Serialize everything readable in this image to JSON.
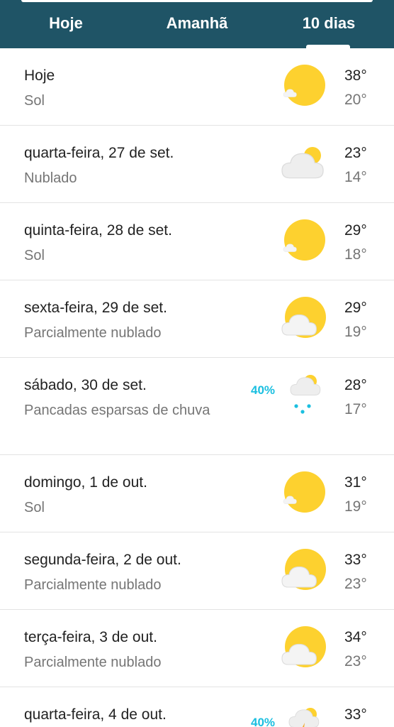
{
  "tabs": [
    {
      "label": "Hoje"
    },
    {
      "label": "Amanhã"
    },
    {
      "label": "10 dias"
    }
  ],
  "selected_tab": "10 dias",
  "colors": {
    "header": "#1f5466",
    "sun": "#fdd12f",
    "cloud": "#eeeeee",
    "rain": "#1bbfe0",
    "primary_text": "#222222",
    "secondary_text": "#757575"
  },
  "days": [
    {
      "date": "Hoje",
      "condition": "Sol",
      "high": "38°",
      "low": "20°",
      "icon": "sun-icon",
      "precip": ""
    },
    {
      "date": "quarta-feira, 27 de set.",
      "condition": "Nublado",
      "high": "23°",
      "low": "14°",
      "icon": "cloudy-icon",
      "precip": ""
    },
    {
      "date": "quinta-feira, 28 de set.",
      "condition": "Sol",
      "high": "29°",
      "low": "18°",
      "icon": "sun-icon",
      "precip": ""
    },
    {
      "date": "sexta-feira, 29 de set.",
      "condition": "Parcialmente nublado",
      "high": "29°",
      "low": "19°",
      "icon": "partly-cloudy-icon",
      "precip": ""
    },
    {
      "date": "sábado, 30 de set.",
      "condition": "Pancadas esparsas de chuva",
      "high": "28°",
      "low": "17°",
      "icon": "rain-showers-icon",
      "precip": "40%"
    },
    {
      "date": "domingo, 1 de out.",
      "condition": "Sol",
      "high": "31°",
      "low": "19°",
      "icon": "sun-icon",
      "precip": ""
    },
    {
      "date": "segunda-feira, 2 de out.",
      "condition": "Parcialmente nublado",
      "high": "33°",
      "low": "23°",
      "icon": "partly-cloudy-icon",
      "precip": ""
    },
    {
      "date": "terça-feira, 3 de out.",
      "condition": "Parcialmente nublado",
      "high": "34°",
      "low": "23°",
      "icon": "partly-cloudy-icon",
      "precip": ""
    },
    {
      "date": "quarta-feira, 4 de out.",
      "condition": "",
      "high": "33°",
      "low": "",
      "icon": "thunderstorm-icon",
      "precip": "40%"
    }
  ]
}
